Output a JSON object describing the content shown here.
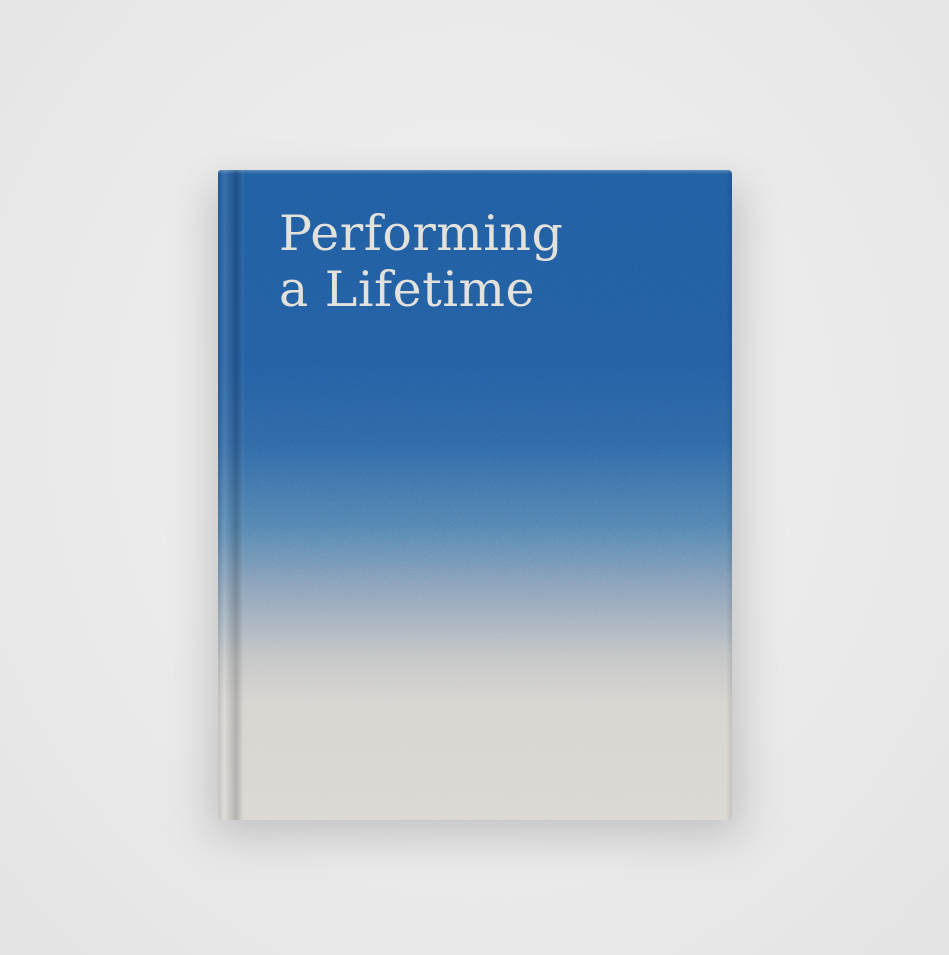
{
  "book": {
    "title_line_1": "Performing",
    "title_line_2": "a Lifetime"
  },
  "colors": {
    "background": "#ebebeb",
    "cover_blue": "#1f5a9e",
    "cover_cream": "#dcd9d5",
    "title_text": "#e3e1dc"
  }
}
